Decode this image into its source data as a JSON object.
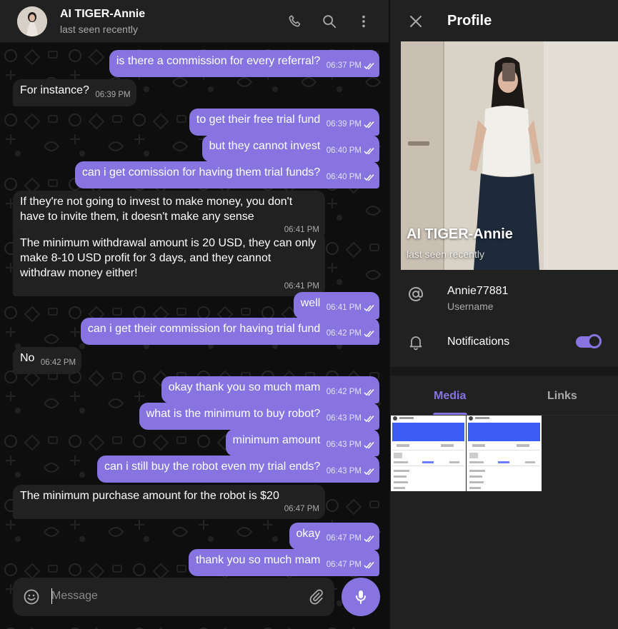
{
  "chat": {
    "contact_name": "AI TIGER-Annie",
    "contact_status": "last seen recently",
    "composer_placeholder": "Message",
    "messages": [
      {
        "dir": "out",
        "text": "is there a commission for every referral?",
        "time": "06:37 PM"
      },
      {
        "dir": "in",
        "text": "For instance?",
        "time": "06:39 PM"
      },
      {
        "dir": "out",
        "text": "to get their free trial fund",
        "time": "06:39 PM"
      },
      {
        "dir": "out",
        "text": "but they cannot invest",
        "time": "06:40 PM"
      },
      {
        "dir": "out",
        "text": "can i get comission for having them trial funds?",
        "time": "06:40 PM"
      },
      {
        "dir": "in",
        "text": "If they're not going to invest to make money, you don't have to invite them, it doesn't make any sense",
        "time": "06:41 PM"
      },
      {
        "dir": "in",
        "text": "The minimum withdrawal amount is 20 USD, they can only make 8-10 USD profit for 3 days, and they cannot withdraw money either!",
        "time": "06:41 PM"
      },
      {
        "dir": "out",
        "text": "well",
        "time": "06:41 PM"
      },
      {
        "dir": "out",
        "text": "can i get their commission for having trial fund",
        "time": "06:42 PM"
      },
      {
        "dir": "in",
        "text": "No",
        "time": "06:42 PM"
      },
      {
        "dir": "out",
        "text": "okay thank you so much mam",
        "time": "06:42 PM"
      },
      {
        "dir": "out",
        "text": "what is the minimum to buy robot?",
        "time": "06:43 PM"
      },
      {
        "dir": "out",
        "text": "minimum amount",
        "time": "06:43 PM"
      },
      {
        "dir": "out",
        "text": "can i still buy the robot even my trial ends?",
        "time": "06:43 PM"
      },
      {
        "dir": "in",
        "text": "The minimum purchase amount for the robot is $20",
        "time": "06:47 PM"
      },
      {
        "dir": "out",
        "text": "okay",
        "time": "06:47 PM"
      },
      {
        "dir": "out",
        "text": "thank you so much mam",
        "time": "06:47 PM"
      }
    ]
  },
  "profile": {
    "title": "Profile",
    "name": "AI TIGER-Annie",
    "status": "last seen recently",
    "username": "Annie77881",
    "username_label": "Username",
    "notifications_label": "Notifications",
    "notifications_on": true,
    "tabs": [
      "Media",
      "Links"
    ],
    "active_tab": "Media"
  },
  "colors": {
    "accent": "#8774e1",
    "outgoing_bubble": "#8774e1",
    "incoming_bubble": "#212121",
    "panel": "#212121",
    "background": "#0e0e0e"
  }
}
